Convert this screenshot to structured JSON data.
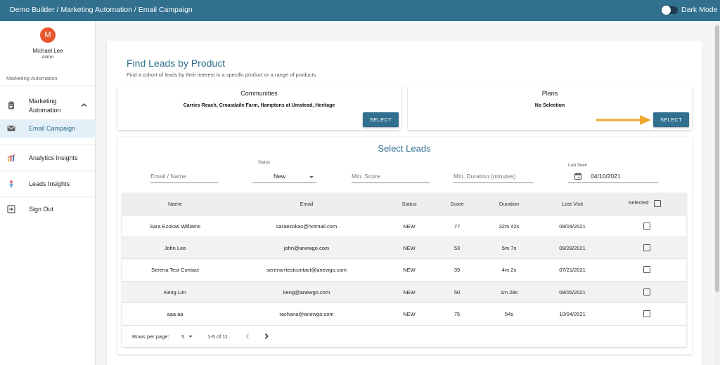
{
  "topbar": {
    "crumb1": "Demo Builder",
    "sep1": " / ",
    "crumb2": "Marketing Automation",
    "sep2": " / ",
    "crumb3": "Email Campaign",
    "dark_mode_label": "Dark Mode",
    "color": "#31708f"
  },
  "sidebar": {
    "avatar_initial": "M",
    "avatar_color": "#e8572e",
    "user_name": "Michael Lee",
    "user_role": "Admin",
    "section_label": "Marketing Automation",
    "items": [
      {
        "label_line1": "Marketing",
        "label_line2": "Automation",
        "icon": "clipboard-icon",
        "expanded": true
      },
      {
        "label": "Email Campaign",
        "icon": "email-icon",
        "active": true
      },
      {
        "label": "Analytics Insights",
        "icon": "analytics-icon"
      },
      {
        "label": "Leads Insights",
        "icon": "leads-icon"
      },
      {
        "label": "Sign Out",
        "icon": "sign-out-icon"
      }
    ]
  },
  "main": {
    "title": "Find Leads by Product",
    "subtitle": "Find a cohort of leads by their interest in a specific product or a range of products.",
    "communities": {
      "header": "Communities",
      "value": "Carries Reach, Croasdaile Farm, Hamptons at Umstead, Heritage",
      "button": "SELECT"
    },
    "plans": {
      "header": "Plans",
      "value": "No Selection",
      "button": "SELECT"
    },
    "leads_title": "Select Leads",
    "filters": {
      "email_placeholder": "Email / Name",
      "status_label": "Status",
      "status_value": "New",
      "min_score_placeholder": "Min. Score",
      "min_duration_placeholder": "Min. Duration (minutes)",
      "last_seen_label": "Last Seen",
      "last_seen_value": "04/10/2021"
    },
    "table": {
      "headers": [
        "Name",
        "Email",
        "Status",
        "Score",
        "Duration",
        "Last Visit",
        "Selected"
      ],
      "rows": [
        [
          "Sara Ezokas Williams",
          "saraezokas@hotmail.com",
          "NEW",
          "77",
          "32m 42s",
          "08/04/2021"
        ],
        [
          "John Lee",
          "john@anewgo.com",
          "NEW",
          "53",
          "5m 7s",
          "09/28/2021"
        ],
        [
          "Serena Test Contact",
          "serena+testcontact@anewgo.com",
          "NEW",
          "39",
          "4m 2s",
          "07/21/2021"
        ],
        [
          "Keng Lim",
          "keng@anewgo.com",
          "NEW",
          "50",
          "1m 28s",
          "08/05/2021"
        ],
        [
          "aaa aa",
          "rachana@anewgo.com",
          "NEW",
          "75",
          "54s",
          "10/04/2021"
        ]
      ]
    },
    "pagination": {
      "rows_per_page_label": "Rows per page:",
      "rows_per_page_value": "5",
      "range": "1-5 of 11"
    },
    "arrow_color": "#f0a830"
  }
}
